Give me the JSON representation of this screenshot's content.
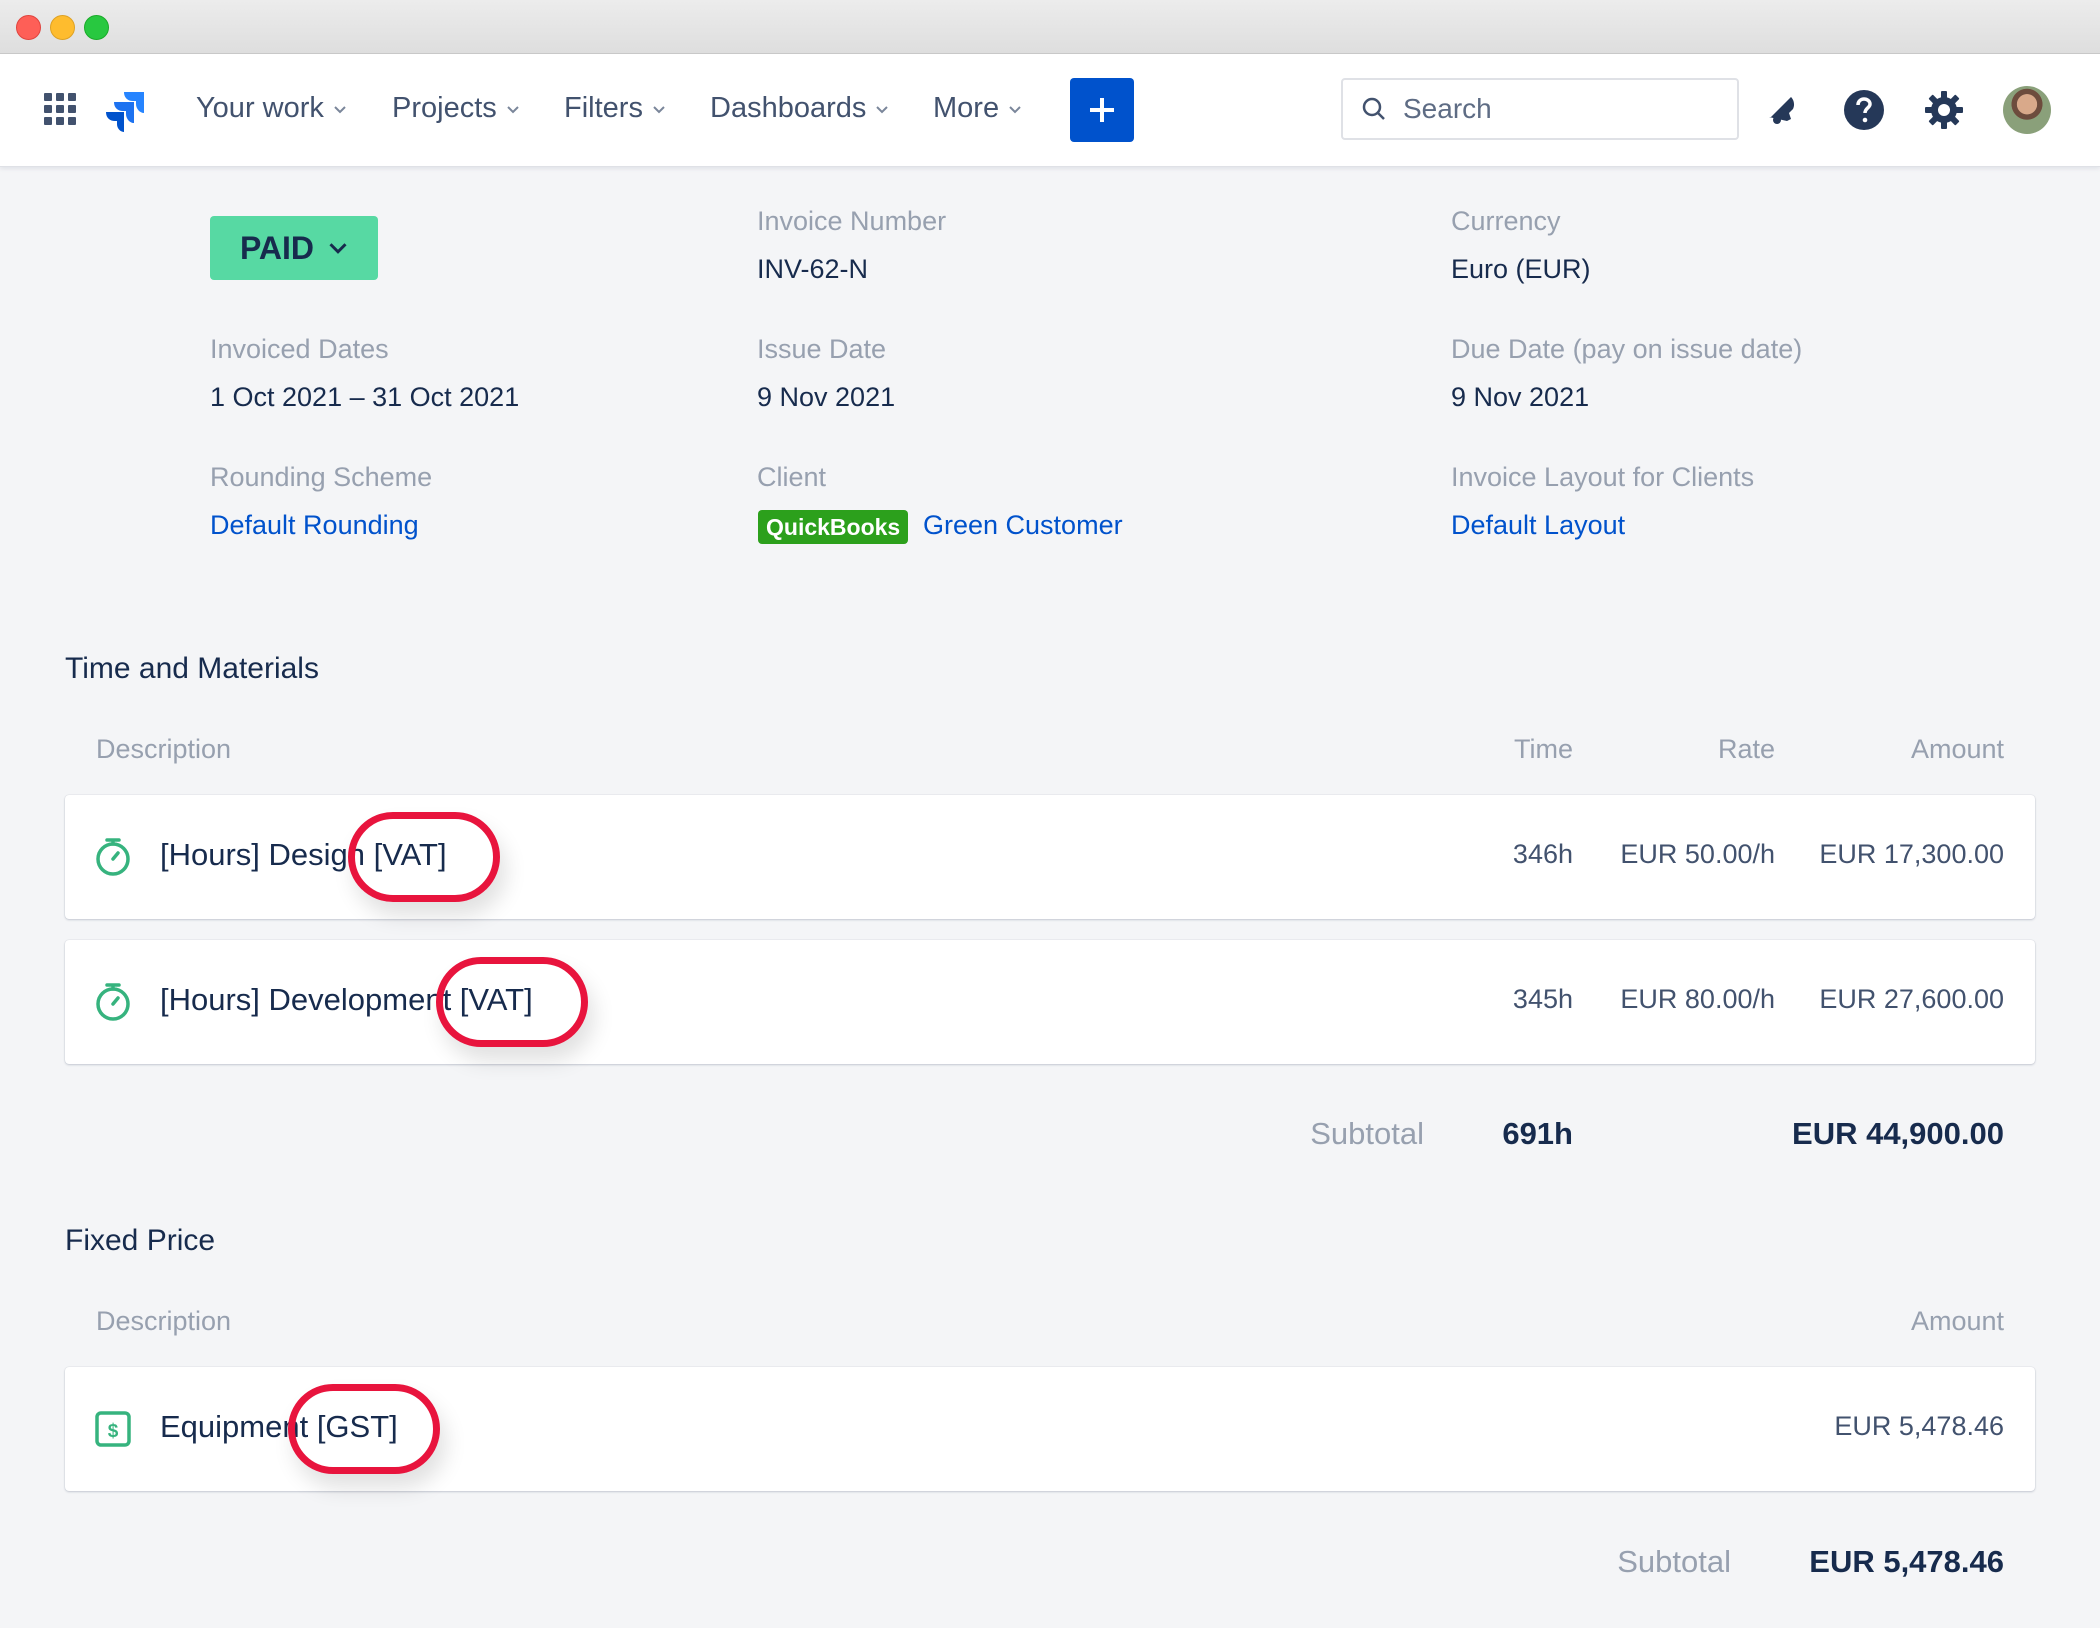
{
  "nav": {
    "items": [
      {
        "label": "Your work"
      },
      {
        "label": "Projects"
      },
      {
        "label": "Filters"
      },
      {
        "label": "Dashboards"
      },
      {
        "label": "More"
      }
    ],
    "search_placeholder": "Search"
  },
  "invoice": {
    "status": "PAID",
    "fields": {
      "invoice_number": {
        "label": "Invoice Number",
        "value": "INV-62-N"
      },
      "currency": {
        "label": "Currency",
        "value": "Euro (EUR)"
      },
      "invoiced_dates": {
        "label": "Invoiced Dates",
        "value": "1 Oct 2021 – 31 Oct 2021"
      },
      "issue_date": {
        "label": "Issue Date",
        "value": "9 Nov 2021"
      },
      "due_date": {
        "label": "Due Date (pay on issue date)",
        "value": "9 Nov 2021"
      },
      "rounding": {
        "label": "Rounding Scheme",
        "value": "Default Rounding"
      },
      "client": {
        "label": "Client",
        "badge": "QuickBooks",
        "value": "Green Customer"
      },
      "layout": {
        "label": "Invoice Layout for Clients",
        "value": "Default Layout"
      }
    }
  },
  "time_materials": {
    "title": "Time and Materials",
    "columns": {
      "description": "Description",
      "time": "Time",
      "rate": "Rate",
      "amount": "Amount"
    },
    "rows": [
      {
        "description": "[Hours] Design [VAT]",
        "time": "346h",
        "rate": "EUR 50.00/h",
        "amount": "EUR 17,300.00"
      },
      {
        "description": "[Hours] Development [VAT]",
        "time": "345h",
        "rate": "EUR 80.00/h",
        "amount": "EUR 27,600.00"
      }
    ],
    "subtotal": {
      "label": "Subtotal",
      "time": "691h",
      "amount": "EUR 44,900.00"
    }
  },
  "fixed_price": {
    "title": "Fixed Price",
    "columns": {
      "description": "Description",
      "amount": "Amount"
    },
    "rows": [
      {
        "description": "Equipment [GST]",
        "amount": "EUR 5,478.46"
      }
    ],
    "subtotal": {
      "label": "Subtotal",
      "amount": "EUR 5,478.46"
    }
  },
  "colors": {
    "accent": "#0052cc",
    "status_green": "#57d9a3",
    "highlight_red": "#e8143d",
    "quickbooks_green": "#2ca01c"
  }
}
